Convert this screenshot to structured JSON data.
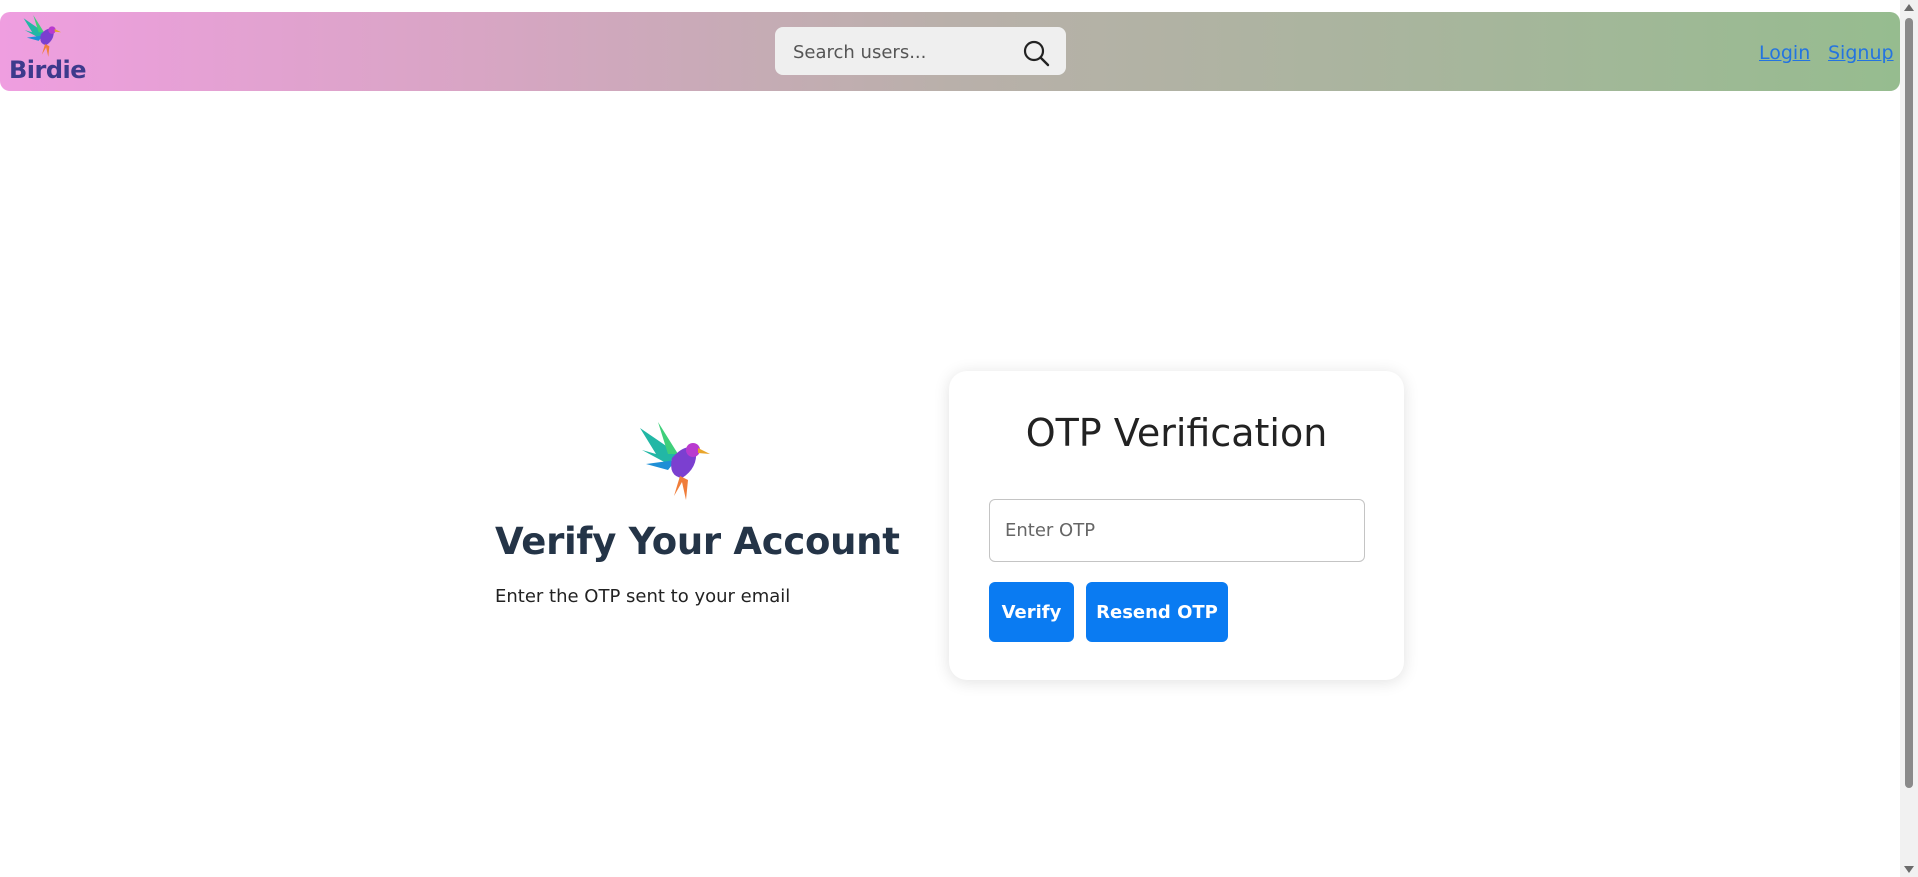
{
  "navbar": {
    "brand": {
      "name": "Birdie",
      "logo_icon": "hummingbird-logo-icon"
    },
    "search": {
      "placeholder": "Search users...",
      "value": "",
      "icon": "search-icon"
    },
    "links": [
      {
        "label": "Login"
      },
      {
        "label": "Signup"
      }
    ],
    "gradient": {
      "start": "#ef9ee0",
      "end": "#96bc8f"
    }
  },
  "hero": {
    "logo_icon": "hummingbird-logo-icon",
    "title": "Verify Your Account",
    "subtitle": "Enter the OTP sent to your email"
  },
  "otp_card": {
    "title": "OTP Verification",
    "input": {
      "placeholder": "Enter OTP",
      "value": ""
    },
    "verify_label": "Verify",
    "resend_label": "Resend OTP"
  },
  "colors": {
    "accent": "#0a7bf2",
    "link": "#2474e0",
    "brand_text": "#3d3a8c",
    "heading": "#243447"
  }
}
